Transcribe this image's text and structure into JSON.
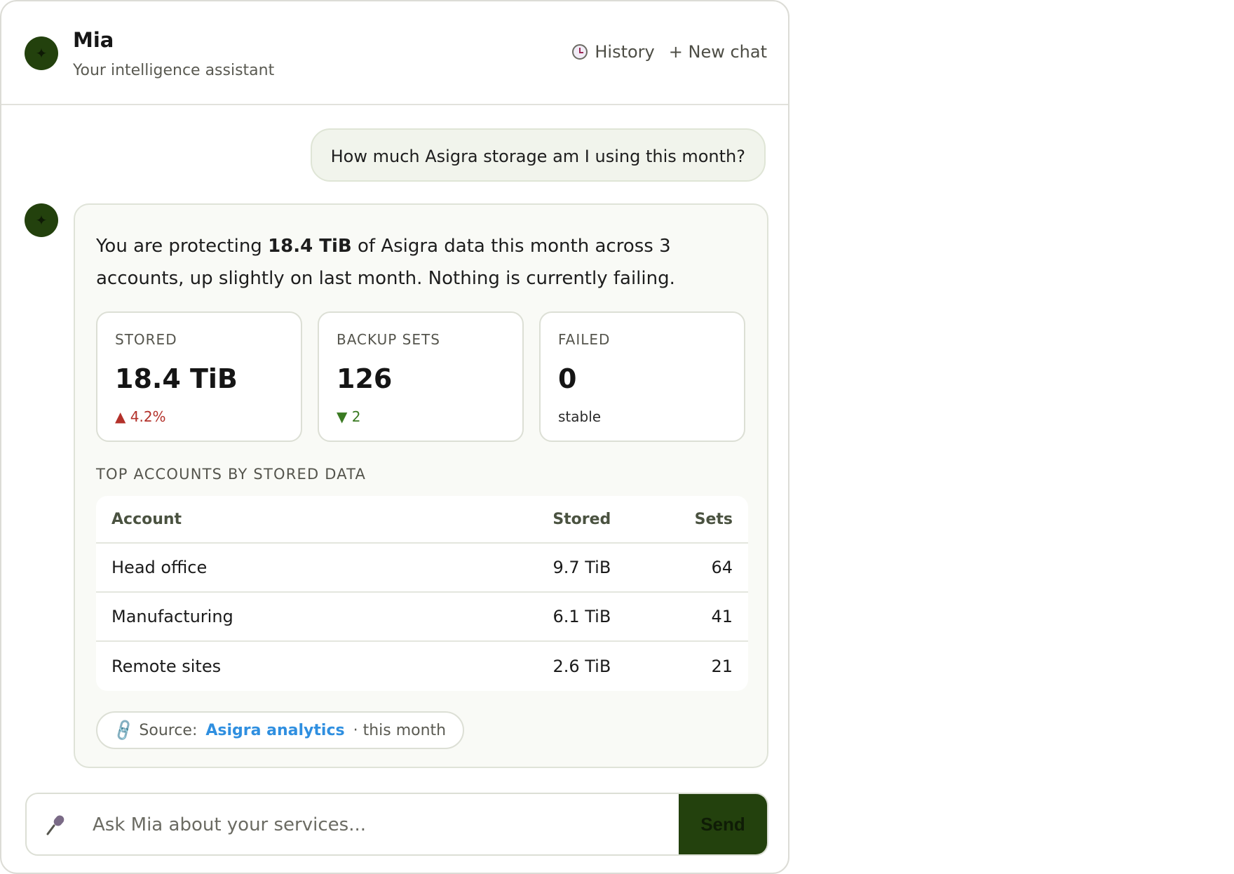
{
  "header": {
    "avatar_glyph": "✦",
    "title": "Mia",
    "subtitle": "Your intelligence assistant",
    "history_label": "History",
    "new_chat_label": "+ New chat"
  },
  "user_message": "How much Asigra storage am I using this month?",
  "bot": {
    "avatar_glyph": "✦",
    "text_before": "You are protecting ",
    "text_bold": "18.4 TiB",
    "text_after": " of Asigra data this month across 3 accounts, up slightly on last month. Nothing is currently failing.",
    "kpis": [
      {
        "label": "STORED",
        "value": "18.4 TiB",
        "delta": "▲ 4.2%",
        "trend": "up"
      },
      {
        "label": "BACKUP SETS",
        "value": "126",
        "delta": "▼ 2",
        "trend": "down"
      },
      {
        "label": "FAILED",
        "value": "0",
        "delta": "stable",
        "trend": "neutral"
      }
    ],
    "section_label": "TOP ACCOUNTS BY STORED DATA",
    "table": {
      "headers": [
        "Account",
        "Stored",
        "Sets"
      ],
      "rows": [
        [
          "Head office",
          "9.7 TiB",
          "64"
        ],
        [
          "Manufacturing",
          "6.1 TiB",
          "41"
        ],
        [
          "Remote sites",
          "2.6 TiB",
          "21"
        ]
      ]
    },
    "source": {
      "prefix": "Source:",
      "link": "Asigra analytics",
      "suffix": "· this month"
    }
  },
  "composer": {
    "placeholder": "Ask Mia about your services...",
    "send_label": "Send"
  },
  "colors": {
    "accent": "#23410d",
    "up": "#b3312a",
    "down": "#3a7a22",
    "link": "#2f8fe0"
  }
}
